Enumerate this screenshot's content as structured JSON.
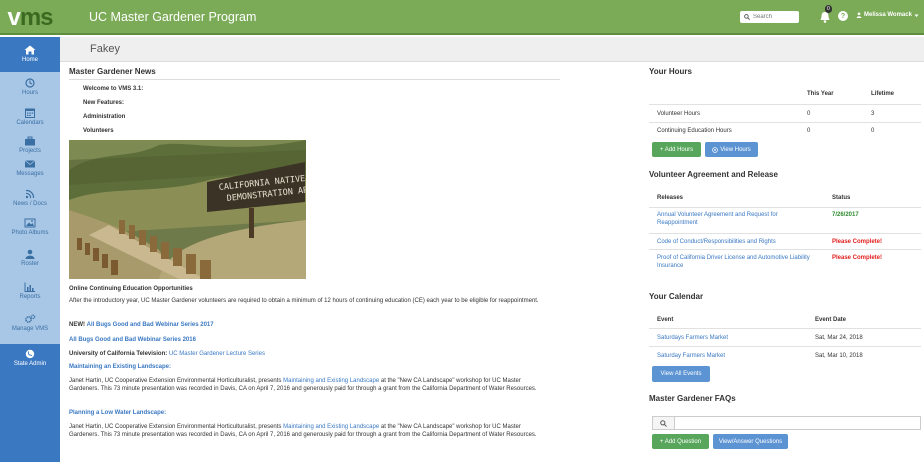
{
  "header": {
    "logo_v": "v",
    "logo_rest": "ms",
    "app_title": "UC Master Gardener Program",
    "search_placeholder": "Search",
    "notification_count": "0",
    "help_glyph": "?",
    "user_name": "Melissa Womack",
    "brand_color": "#7bab57"
  },
  "sidebar": {
    "items": [
      {
        "label": "Home",
        "icon": "home-icon"
      },
      {
        "label": "Hours",
        "icon": "clock-icon"
      },
      {
        "label": "Calendars",
        "icon": "calendar-icon"
      },
      {
        "label": "Projects",
        "icon": "briefcase-icon"
      },
      {
        "label": "Messages",
        "icon": "envelope-icon"
      },
      {
        "label": "News / Docs",
        "icon": "rss-icon"
      },
      {
        "label": "Photo Albums",
        "icon": "picture-icon"
      },
      {
        "label": "Roster",
        "icon": "user-icon"
      },
      {
        "label": "Reports",
        "icon": "bar-chart-icon"
      },
      {
        "label": "Manage VMS",
        "icon": "cogs-icon"
      },
      {
        "label": "State Admin",
        "icon": "globe-icon"
      }
    ]
  },
  "page": {
    "title": "Fakey"
  },
  "news": {
    "title": "Master Gardener News",
    "welcome": "Welcome to VMS 3.1:",
    "new_features": "New Features:",
    "administration": "Administration",
    "volunteers": "Volunteers",
    "photo_sign_line1": "CALIFORNIA NATIVE PLANT",
    "photo_sign_line2": "DEMONSTRATION ARE",
    "ce_heading": "Online Continuing Education Opportunities",
    "ce_text": "After the introductory year, UC Master Gardener volunteers are required to obtain a minimum of 12 hours of continuing education (CE) each year to be eligible for reappointment.",
    "new_prefix": "NEW!",
    "webinar_2017": "All Bugs Good and Bad Webinar Series 2017",
    "webinar_2016": "All Bugs Good and Bad Webinar Series 2016",
    "uctv_prefix": "University of California Television:",
    "uctv_link": "UC Master Gardener Lecture Series",
    "maintaining_heading": "Maintaining an Existing Landscape:",
    "maintaining_p1": "Janet Hartin, UC Cooperative Extension Environmental Horticulturalist, presents",
    "maintaining_link": "Maintaining and Existing Landscape",
    "maintaining_p2": "at the \"New CA Landscape\" workshop for UC Master Gardeners. This 73 minute presentation was recorded in Davis, CA on April 7, 2016 and generously paid for through a grant from the California Department of Water Resources.",
    "planning_heading": "Planning a Low Water Landscape:",
    "planning_p1": "Janet Hartin, UC Cooperative Extension Environmental Horticulturalist, presents",
    "planning_link": "Maintaining and Existing Landscape",
    "planning_p2": "at the \"New CA Landscape\" workshop for UC Master Gardeners. This 73 minute presentation was recorded in Davis, CA on April 7, 2016 and generously paid for through a grant from the California Department of Water Resources."
  },
  "hours": {
    "title": "Your Hours",
    "col_this_year": "This Year",
    "col_lifetime": "Lifetime",
    "rows": [
      {
        "label": "Volunteer Hours",
        "this_year": "0",
        "lifetime": "3"
      },
      {
        "label": "Continuing Education Hours",
        "this_year": "0",
        "lifetime": "0"
      }
    ],
    "add_btn": "+ Add Hours",
    "view_btn": "View Hours"
  },
  "agreement": {
    "title": "Volunteer Agreement and Release",
    "col_releases": "Releases",
    "col_status": "Status",
    "rows": [
      {
        "release": "Annual Volunteer Agreement and Request for Reappointment",
        "status": "7/26/2017"
      },
      {
        "release": "Code of Conduct/Responsibilities and Rights",
        "status": "Please Complete!"
      },
      {
        "release": "Proof of California Driver License and Automotive Liability Insurance",
        "status": "Please Complete!"
      }
    ]
  },
  "calendar": {
    "title": "Your Calendar",
    "col_event": "Event",
    "col_date": "Event Date",
    "rows": [
      {
        "event": "Saturdays Farmers Market",
        "date": "Sat, Mar 24, 2018"
      },
      {
        "event": "Saturday Farmers Market",
        "date": "Sat, Mar 10, 2018"
      }
    ],
    "view_all_btn": "View All Events"
  },
  "faqs": {
    "title": "Master Gardener FAQs",
    "add_btn": "+ Add Question",
    "view_btn": "View/Answer Questions"
  }
}
